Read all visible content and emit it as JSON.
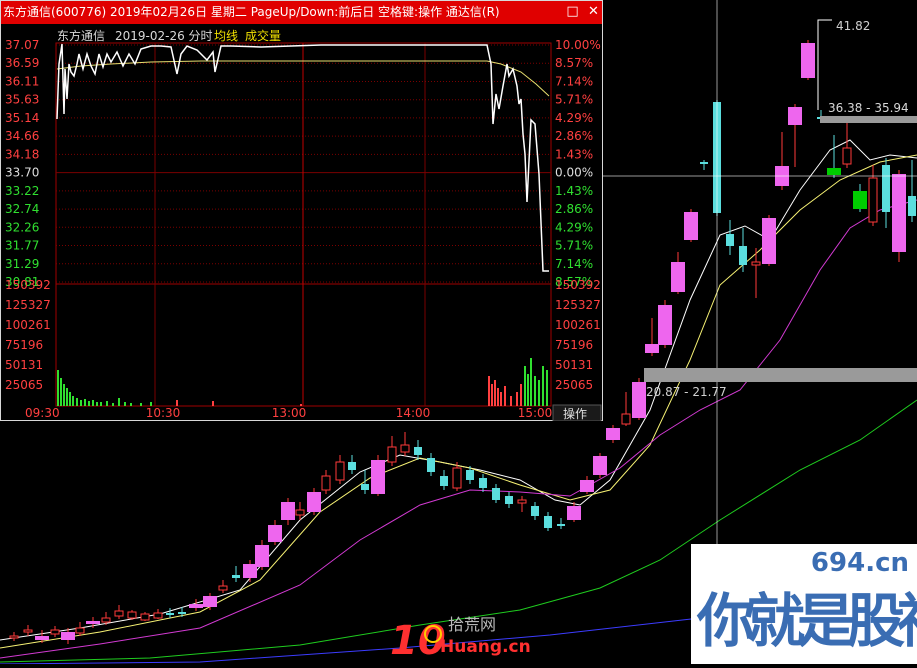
{
  "kline": {
    "colors": {
      "up": "#ff3a3a",
      "up_fill": "#000000",
      "up_big": "#ee66ee",
      "down": "#5bdede",
      "down_big": "#00cc00",
      "ma5": "#ffffff",
      "ma10": "#f7f274",
      "ma20": "#d23ad2",
      "ma60": "#1fcc1f",
      "ma120": "#3c3cff"
    },
    "ann_high": "41.82",
    "ann_mid": "36.38 - 35.94",
    "ann_low": "20.87 - 21.77"
  },
  "window": {
    "title": "东方通信(600776)  2019年02月26日  星期二  PageUp/Down:前后日  空格键:操作  通达信(R)",
    "min_icon": "minimize-icon",
    "close_icon": "close-icon",
    "min_glyph": "□",
    "close_glyph": "✕"
  },
  "intraday": {
    "stock_name": "东方通信",
    "date_label": "2019-02-26 分时",
    "avg_label": "均线",
    "vol_label": "成交量",
    "price_axis": [
      "37.07",
      "36.59",
      "36.11",
      "35.63",
      "35.14",
      "34.66",
      "34.18",
      "33.70",
      "33.22",
      "32.74",
      "32.26",
      "31.77",
      "31.29",
      "30.81"
    ],
    "pct_axis": [
      "10.00%",
      "8.57%",
      "7.14%",
      "5.71%",
      "4.29%",
      "2.86%",
      "1.43%",
      "0.00%",
      "1.43%",
      "2.86%",
      "4.29%",
      "5.71%",
      "7.14%",
      "8.57%"
    ],
    "vol_axis": [
      "150392",
      "125327",
      "100261",
      "75196",
      "50131",
      "25065"
    ],
    "time_axis": [
      "09:30",
      "10:30",
      "13:00",
      "14:00",
      "15:00"
    ],
    "op_button": "操作",
    "prev_close": 33.7,
    "price_max": 37.07,
    "price_min": 30.81
  },
  "watermarks": {
    "site1_number": "10",
    "site1_cn": "拾荒网",
    "site1_en": "Huang.cn",
    "site2_domain": "694.cn",
    "site2_cn": "你就是股神"
  }
}
